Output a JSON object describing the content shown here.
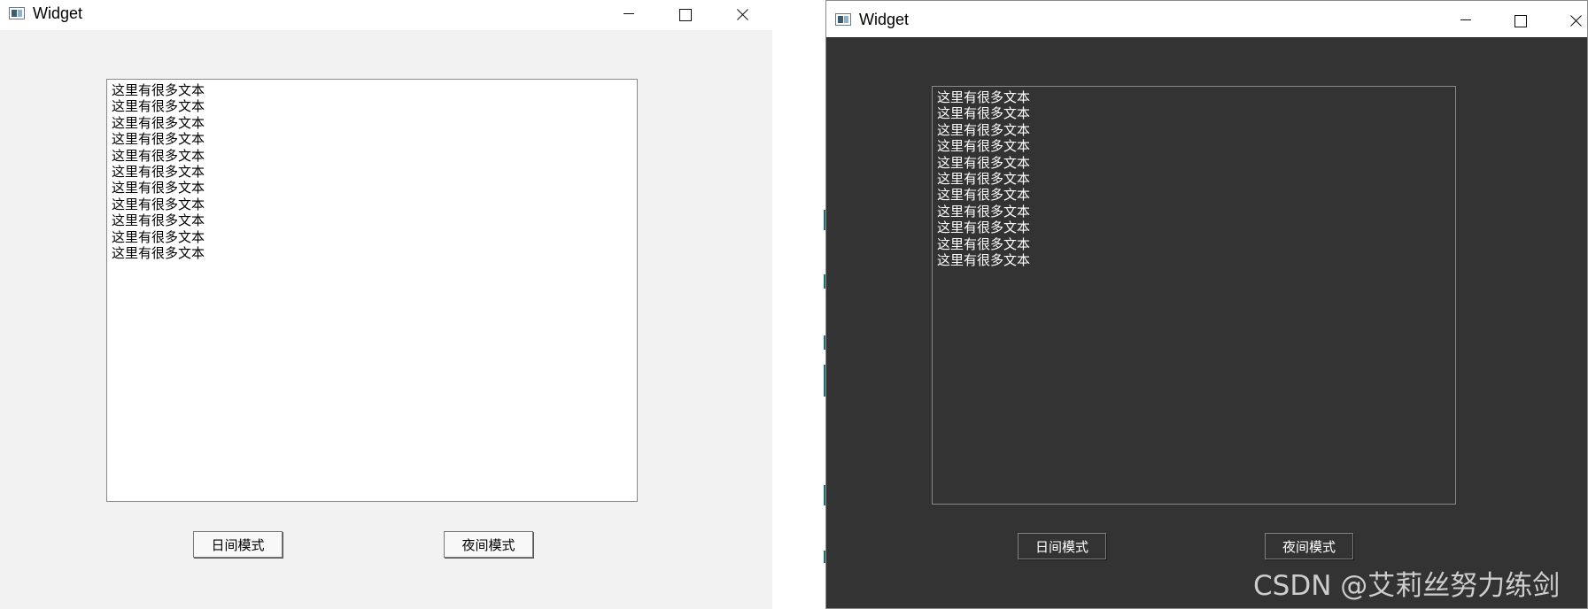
{
  "light_window": {
    "title": "Widget",
    "text_lines": [
      "这里有很多文本",
      "这里有很多文本",
      "这里有很多文本",
      "这里有很多文本",
      "这里有很多文本",
      "这里有很多文本",
      "这里有很多文本",
      "这里有很多文本",
      "这里有很多文本",
      "这里有很多文本",
      "这里有很多文本"
    ],
    "day_button_label": "日间模式",
    "night_button_label": "夜间模式"
  },
  "dark_window": {
    "title": "Widget",
    "text_lines": [
      "这里有很多文本",
      "这里有很多文本",
      "这里有很多文本",
      "这里有很多文本",
      "这里有很多文本",
      "这里有很多文本",
      "这里有很多文本",
      "这里有很多文本",
      "这里有很多文本",
      "这里有很多文本",
      "这里有很多文本"
    ],
    "day_button_label": "日间模式",
    "night_button_label": "夜间模式"
  },
  "watermark": "CSDN @艾莉丝努力练剑",
  "icons": {
    "app": "app-window-icon",
    "minimize": "minimize-icon",
    "maximize": "maximize-icon",
    "close": "close-icon"
  },
  "colors": {
    "light_background": "#f2f2f2",
    "light_text_area": "#ffffff",
    "dark_background": "#333333",
    "dark_text": "#ffffff",
    "border": "#8a8a8a"
  }
}
